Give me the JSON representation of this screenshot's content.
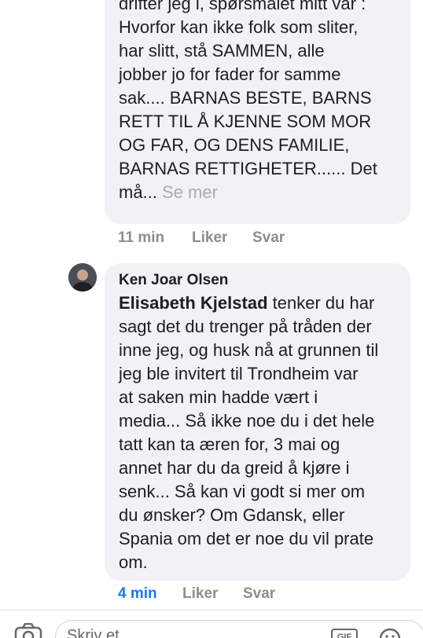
{
  "comments": [
    {
      "text_lines": [
        "drifter jeg i, spørsmålet mitt var :",
        "Hvorfor kan ikke folk som sliter,",
        "har slitt, stå SAMMEN, alle",
        "jobber jo for fader for samme",
        "sak.... BARNAS BESTE, BARNS",
        "RETT TIL Å KJENNE SOM MOR",
        "OG FAR, OG DENS FAMILIE,",
        "BARNAS RETTIGHETER...... Det"
      ],
      "last_line": "må...",
      "see_more": "Se mer",
      "time": "11 min",
      "like": "Liker",
      "reply": "Svar"
    },
    {
      "author": "Ken Joar Olsen",
      "mention": "Elisabeth Kjelstad",
      "first_line_rest": " tenker du har",
      "text_lines": [
        "sagt det du trenger på tråden der",
        "inne jeg, og husk nå at grunnen til",
        "jeg ble invitert til Trondheim var",
        "at saken min hadde vært i",
        "media... Så ikke noe du i det hele",
        "tatt kan ta æren for, 3 mai og",
        "annet har du da greid å kjøre i",
        "senk... Så kan vi godt si mer om",
        "du ønsker? Om Gdansk, eller",
        "Spania om det er noe du vil prate",
        "om."
      ],
      "time": "4 min",
      "like": "Liker",
      "reply": "Svar"
    }
  ],
  "composer": {
    "placeholder": "Skriv et…",
    "gif_label": "GIF"
  },
  "colors": {
    "bubble_bg": "#f0f2f5",
    "meta_gray": "#8a8d91",
    "link_blue": "#1877f2"
  }
}
